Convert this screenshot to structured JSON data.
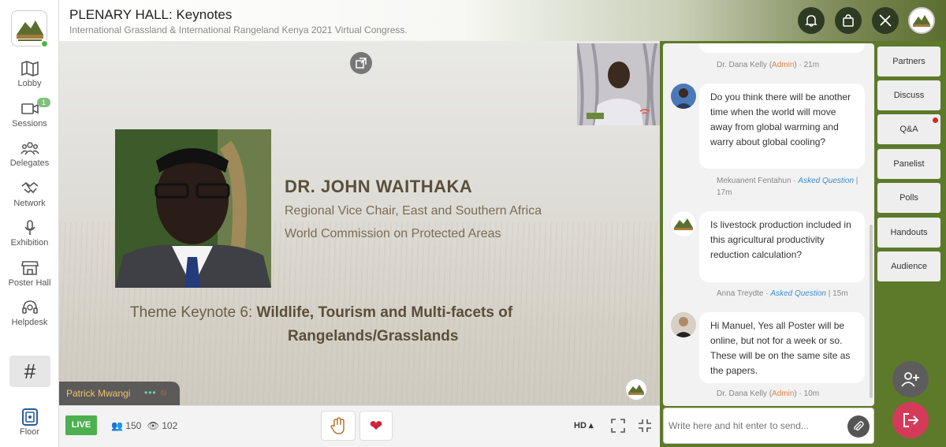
{
  "header": {
    "title": "PLENARY HALL: Keynotes",
    "subtitle": "International Grassland & International Rangeland Kenya 2021 Virtual Congress."
  },
  "sidebar": {
    "items": [
      {
        "label": "Lobby",
        "icon": "map-icon"
      },
      {
        "label": "Sessions",
        "icon": "video-icon",
        "badge": "1"
      },
      {
        "label": "Delegates",
        "icon": "people-icon"
      },
      {
        "label": "Network",
        "icon": "handshake-icon"
      },
      {
        "label": "Exhibition",
        "icon": "microphone-icon"
      },
      {
        "label": "Poster Hall",
        "icon": "store-icon"
      },
      {
        "label": "Helpdesk",
        "icon": "headset-icon"
      }
    ],
    "hashtag": "#",
    "floor_label": "Floor"
  },
  "stage": {
    "speaker_name": "DR. JOHN WAITHAKA",
    "speaker_role_1": "Regional Vice Chair, East and Southern Africa",
    "speaker_role_2": "World Commission on Protected Areas",
    "theme_prefix": "Theme Keynote 6: ",
    "theme_bold_1": "Wildlife, Tourism and Multi-facets of",
    "theme_bold_2": "Rangelands/Grasslands",
    "presenter_name": "Patrick Mwangi"
  },
  "controls": {
    "live_label": "LIVE",
    "attendees": "150",
    "viewers": "102",
    "quality": "HD"
  },
  "chat": {
    "top_meta": {
      "author": "Dr. Dana Kelly",
      "role": "Admin",
      "time": "21m"
    },
    "messages": [
      {
        "text": "Do you think there will be another time when the world will move away from global warming and warry about global cooling?",
        "author": "Mekuanent Fentahun",
        "tag": "Asked Question",
        "time": "17m"
      },
      {
        "text": "Is livestock production included in this agricultural productivity reduction calculation?",
        "author": "Anna Treydte",
        "tag": "Asked Question",
        "time": "15m"
      },
      {
        "text": "Hi Manuel, Yes all Poster will be online, but not for a week or so. These will be on the same site as the papers.",
        "author": "Dr. Dana Kelly",
        "role": "Admin",
        "time": "10m"
      }
    ],
    "input_placeholder": "Write here and hit enter to send..."
  },
  "right_tabs": [
    "Partners",
    "Discuss",
    "Q&A",
    "Panelist",
    "Polls",
    "Handouts",
    "Audience"
  ],
  "colors": {
    "live": "#4caf50",
    "admin": "#e0834a",
    "asked": "#3a8ed0",
    "exit": "#d63a5a",
    "green_bg": "#5d7a2a"
  }
}
